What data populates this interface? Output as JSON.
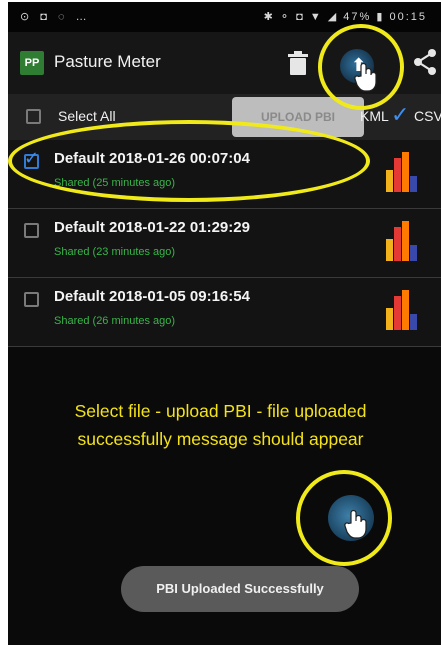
{
  "status_bar": {
    "left_icons": "⊙ ◘ ◌ …",
    "right_text": "✱ ⚬ ◘ ▼ ◢ 47% ▮ 00:15"
  },
  "app_bar": {
    "logo_text": "PP",
    "title": "Pasture Meter"
  },
  "toolbar": {
    "select_all_label": "Select All",
    "upload_label": "UPLOAD PBI",
    "kml_label": "KML",
    "csv_label": "CSV",
    "csv_checked": true
  },
  "files": [
    {
      "name": "Default 2018-01-26 00:07:04",
      "status": "Shared (25 minutes ago)",
      "checked": true
    },
    {
      "name": "Default 2018-01-22 01:29:29",
      "status": "Shared (23 minutes ago)",
      "checked": false
    },
    {
      "name": "Default 2018-01-05 09:16:54",
      "status": "Shared (26 minutes ago)",
      "checked": false
    }
  ],
  "caption": {
    "line1": "Select file - upload PBI - file uploaded",
    "line2": "successfully message should appear"
  },
  "toast": {
    "message": "PBI Uploaded Successfully"
  },
  "colors": {
    "accent_green": "#39b54a",
    "highlight_yellow": "#f1ea1a",
    "check_blue": "#3d8ef0"
  }
}
